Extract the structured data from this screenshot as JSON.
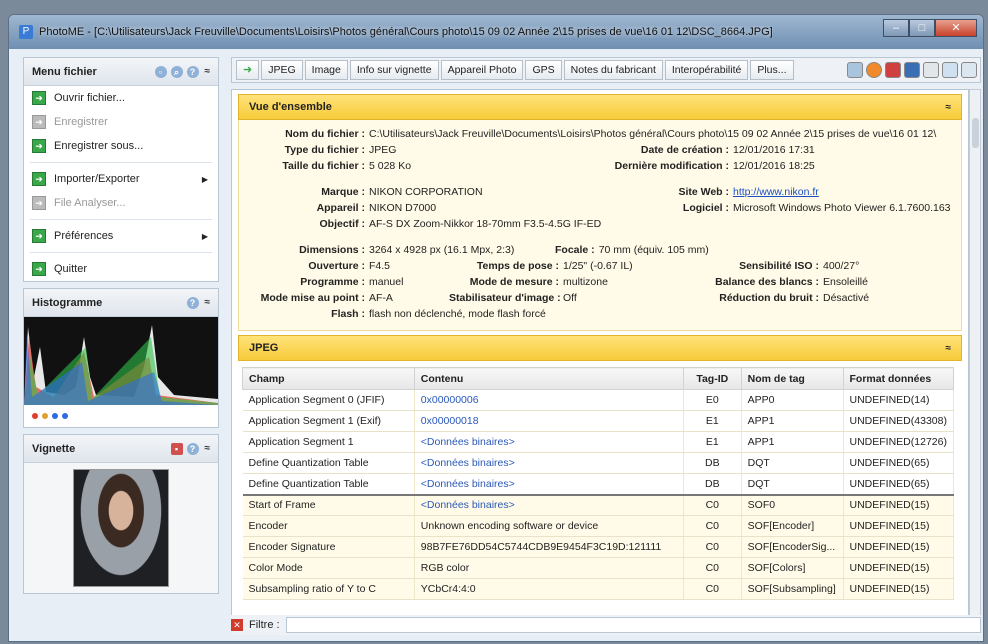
{
  "window": {
    "title": "PhotoME - [C:\\Utilisateurs\\Jack Freuville\\Documents\\Loisirs\\Photos général\\Cours photo\\15 09 02 Année 2\\15 prises de vue\\16 01 12\\DSC_8664.JPG]",
    "min": "–",
    "max": "□",
    "close": "✕"
  },
  "menu": {
    "title": "Menu fichier",
    "items": [
      {
        "label": "Ouvrir fichier...",
        "enabled": true
      },
      {
        "label": "Enregistrer",
        "enabled": false
      },
      {
        "label": "Enregistrer sous...",
        "enabled": true
      },
      {
        "label": "Importer/Exporter",
        "enabled": true
      },
      {
        "label": "File Analyser...",
        "enabled": false
      },
      {
        "label": "Préférences",
        "enabled": true
      },
      {
        "label": "Quitter",
        "enabled": true
      }
    ]
  },
  "histogram": {
    "title": "Histogramme"
  },
  "thumbnail": {
    "title": "Vignette"
  },
  "toolbar": {
    "tabs": [
      "JPEG",
      "Image",
      "Info sur vignette",
      "Appareil Photo",
      "GPS",
      "Notes du fabricant",
      "Interopérabilité",
      "Plus..."
    ]
  },
  "overview": {
    "title": "Vue d'ensemble",
    "filename_label": "Nom du fichier :",
    "filename": "C:\\Utilisateurs\\Jack Freuville\\Documents\\Loisirs\\Photos général\\Cours photo\\15 09 02 Année 2\\15 prises de vue\\16 01 12\\",
    "type_label": "Type du fichier :",
    "type": "JPEG",
    "size_label": "Taille du fichier :",
    "size": "5 028 Ko",
    "created_label": "Date de création :",
    "created": "12/01/2016 17:31",
    "modified_label": "Dernière modification :",
    "modified": "12/01/2016 18:25",
    "brand_label": "Marque :",
    "brand": "NIKON CORPORATION",
    "camera_label": "Appareil :",
    "camera": "NIKON D7000",
    "lens_label": "Objectif :",
    "lens": "AF-S DX Zoom-Nikkor 18-70mm F3.5-4.5G IF-ED",
    "website_label": "Site Web :",
    "website": "http://www.nikon.fr",
    "software_label": "Logiciel :",
    "software": "Microsoft Windows Photo Viewer 6.1.7600.163",
    "dims_label": "Dimensions :",
    "dims": "3264 x 4928 px (16.1 Mpx, 2:3)",
    "focal_label": "Focale :",
    "focal": "70 mm (équiv. 105 mm)",
    "aperture_label": "Ouverture :",
    "aperture": "F4.5",
    "exposure_label": "Temps de pose :",
    "exposure": "1/25\" (-0.67 IL)",
    "iso_label": "Sensibilité ISO :",
    "iso": "400/27°",
    "program_label": "Programme :",
    "program": "manuel",
    "metering_label": "Mode de mesure :",
    "metering": "multizone",
    "wb_label": "Balance des blancs :",
    "wb": "Ensoleillé",
    "focus_label": "Mode mise au point :",
    "focus": "AF-A",
    "stab_label": "Stabilisateur d'image :",
    "stab": "Off",
    "nr_label": "Réduction du bruit :",
    "nr": "Désactivé",
    "flash_label": "Flash :",
    "flash": "flash non déclenché, mode flash forcé"
  },
  "jpeg": {
    "title": "JPEG",
    "headers": [
      "Champ",
      "Contenu",
      "Tag-ID",
      "Nom de tag",
      "Format données"
    ],
    "rows": [
      [
        "Application Segment 0 (JFIF)",
        "0x00000006",
        "E0",
        "APP0",
        "UNDEFINED(14)"
      ],
      [
        "Application Segment 1 (Exif)",
        "0x00000018",
        "E1",
        "APP1",
        "UNDEFINED(43308)"
      ],
      [
        "Application Segment 1",
        "<Données binaires>",
        "E1",
        "APP1",
        "UNDEFINED(12726)"
      ],
      [
        "Define Quantization Table",
        "<Données binaires>",
        "DB",
        "DQT",
        "UNDEFINED(65)"
      ],
      [
        "Define Quantization Table",
        "<Données binaires>",
        "DB",
        "DQT",
        "UNDEFINED(65)"
      ],
      [
        "Start of Frame",
        "<Données binaires>",
        "C0",
        "SOF0",
        "UNDEFINED(15)"
      ],
      [
        "Encoder",
        "Unknown encoding software or device",
        "C0",
        "SOF[Encoder]",
        "UNDEFINED(15)"
      ],
      [
        "Encoder Signature",
        "98B7FE76DD54C5744CDB9E9454F3C19D:121111",
        "C0",
        "SOF[EncoderSig...",
        "UNDEFINED(15)"
      ],
      [
        "Color Mode",
        "RGB color",
        "C0",
        "SOF[Colors]",
        "UNDEFINED(15)"
      ],
      [
        "Subsampling ratio of Y to C",
        "YCbCr4:4:0",
        "C0",
        "SOF[Subsampling]",
        "UNDEFINED(15)"
      ]
    ]
  },
  "filter": {
    "label": "Filtre :"
  }
}
